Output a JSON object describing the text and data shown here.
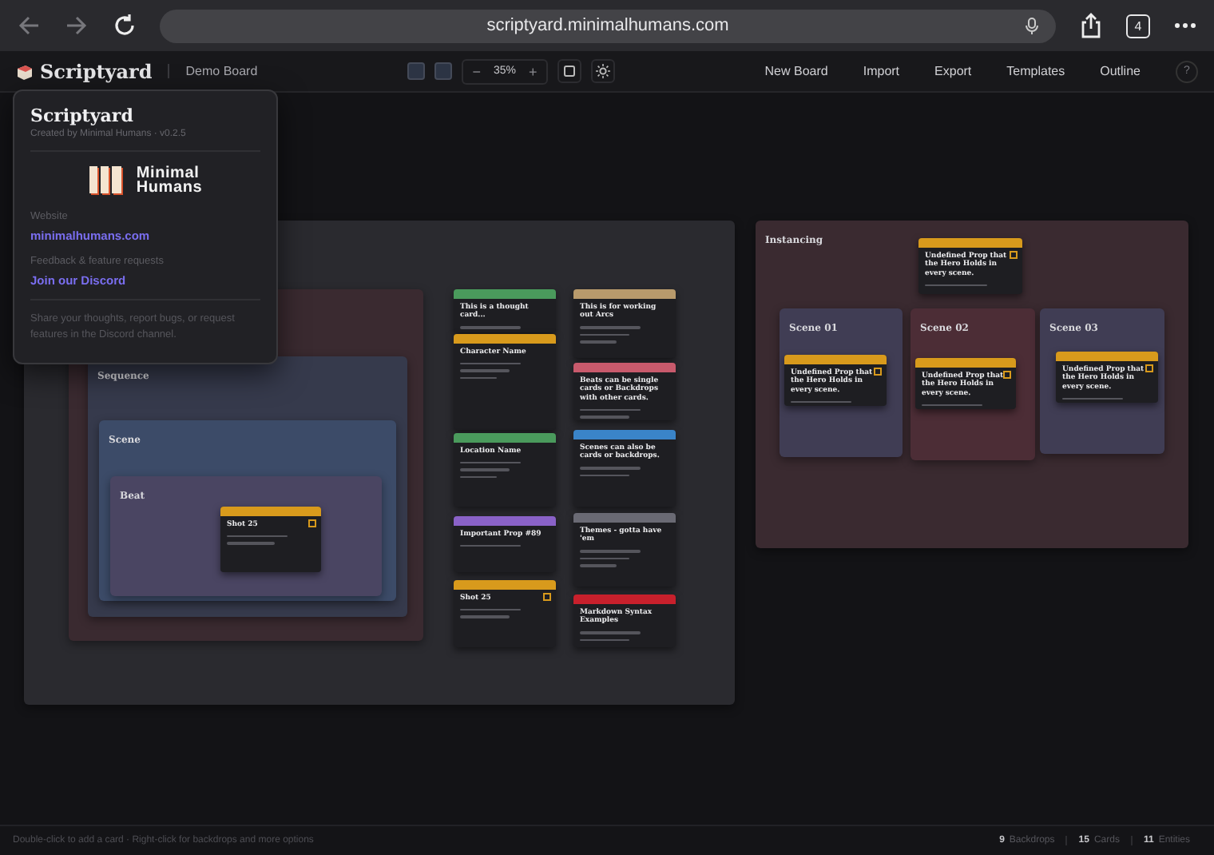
{
  "browser": {
    "url": "scriptyard.minimalhumans.com",
    "tab_count": "4"
  },
  "header": {
    "brand": "Scriptyard",
    "board": "Demo Board",
    "zoom_minus": "−",
    "zoom": "35%",
    "zoom_plus": "+",
    "nav": [
      "New Board",
      "Import",
      "Export",
      "Templates",
      "Outline"
    ],
    "help": "?"
  },
  "about_popup": {
    "title": "Scriptyard",
    "subtitle": "Created by Minimal Humans · v0.2.5",
    "logo_lines": [
      "Minimal",
      "Humans"
    ],
    "website_label": "Website",
    "website_link": "minimalhumans.com",
    "feedback_label": "Feedback & feature requests",
    "discord_link": "Join our Discord",
    "note": "Share your thoughts, report bugs, or request features in the Discord channel."
  },
  "backdrops": [
    {
      "color": "#2a2a2f",
      "cards": [
        {
          "title": "This is a thought card...",
          "color": "#4a9a5c",
          "instanced": false
        },
        {
          "title": "Character Name",
          "color": "#d89a1c",
          "instanced": false
        },
        {
          "title": "Location Name",
          "color": "#4a9a5c",
          "instanced": false
        },
        {
          "title": "Important Prop #89",
          "color": "#8a62c8",
          "instanced": false
        },
        {
          "title": "Shot 25",
          "color": "#d89a1c",
          "instanced": true
        },
        {
          "title": "This is for working out Arcs",
          "color": "#b89a6c",
          "instanced": false
        },
        {
          "title": "Beats can be single cards or Backdrops with other cards.",
          "color": "#c85a6c",
          "instanced": false
        },
        {
          "title": "Scenes can also be cards or backdrops.",
          "color": "#3a84c8",
          "instanced": false
        },
        {
          "title": "Themes - gotta have 'em",
          "color": "#6a6a74",
          "instanced": false
        },
        {
          "title": "Markdown Syntax Examples",
          "color": "#c8202c",
          "instanced": false
        }
      ],
      "children": [
        {
          "color": "#3a2a30",
          "children": [
            {
              "title": "Sequence",
              "color": "#363a4c",
              "children": [
                {
                  "title": "Scene",
                  "color": "#3c4b68",
                  "children": [
                    {
                      "title": "Beat",
                      "color": "#4a4562",
                      "cards": [
                        {
                          "title": "Shot 25",
                          "color": "#d89a1c",
                          "instanced": true
                        }
                      ]
                    }
                  ]
                }
              ]
            }
          ]
        }
      ]
    },
    {
      "title": "Instancing",
      "color": "#3a2a30",
      "cards": [
        {
          "title": "Undefined Prop that the Hero Holds in every scene.",
          "color": "#d89a1c",
          "instanced": true
        }
      ],
      "children": [
        {
          "title": "Scene 01",
          "color": "#403d54",
          "cards": [
            {
              "title": "Undefined Prop that the Hero Holds in every scene.",
              "color": "#d89a1c",
              "instanced": true
            }
          ]
        },
        {
          "title": "Scene 02",
          "color": "#4c2d36",
          "cards": [
            {
              "title": "Undefined Prop that the Hero Holds in every scene.",
              "color": "#d89a1c",
              "instanced": true
            }
          ]
        },
        {
          "title": "Scene 03",
          "color": "#403d54",
          "cards": [
            {
              "title": "Undefined Prop that the Hero Holds in every scene.",
              "color": "#d89a1c",
              "instanced": true
            }
          ]
        }
      ]
    }
  ],
  "status_bar": {
    "hint": "Double-click to add a card · Right-click for backdrops and more options",
    "counts": [
      {
        "value": "9",
        "label": "Backdrops"
      },
      {
        "value": "15",
        "label": "Cards"
      },
      {
        "value": "11",
        "label": "Entities"
      }
    ]
  }
}
